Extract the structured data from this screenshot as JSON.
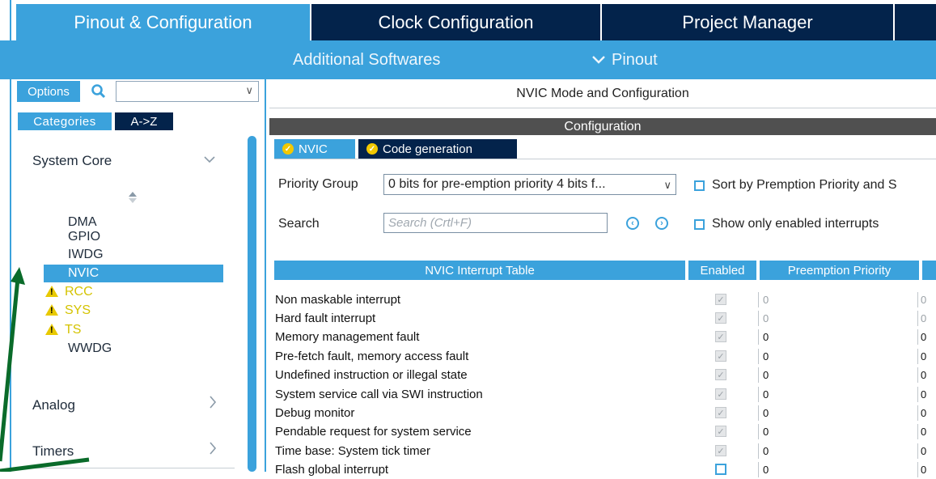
{
  "tabs": {
    "pinout": "Pinout & Configuration",
    "clock": "Clock Configuration",
    "project": "Project Manager"
  },
  "subnav": {
    "additional": "Additional Softwares",
    "pinout": "Pinout"
  },
  "left": {
    "options_label": "Options",
    "categories_label": "Categories",
    "az_label": "A->Z",
    "system_core": "System Core",
    "items": [
      {
        "label": "DMA",
        "state": "normal"
      },
      {
        "label": "GPIO",
        "state": "normal"
      },
      {
        "label": "IWDG",
        "state": "normal"
      },
      {
        "label": "NVIC",
        "state": "selected"
      },
      {
        "label": "RCC",
        "state": "warning"
      },
      {
        "label": "SYS",
        "state": "warning"
      },
      {
        "label": "TS",
        "state": "warning"
      },
      {
        "label": "WWDG",
        "state": "normal"
      }
    ],
    "analog": "Analog",
    "timers": "Timers"
  },
  "right": {
    "title": "NVIC Mode and Configuration",
    "config_header": "Configuration",
    "tab_nvic": "NVIC",
    "tab_codegen": "Code generation",
    "priority_group_label": "Priority Group",
    "priority_group_value": "0 bits for pre-emption priority 4 bits f...",
    "sort_label": "Sort by Premption Priority and S",
    "search_label": "Search",
    "search_placeholder": "Search (Crtl+F)",
    "show_enabled_label": "Show only enabled interrupts",
    "table": {
      "col_name": "NVIC Interrupt Table",
      "col_enabled": "Enabled",
      "col_preemption": "Preemption Priority",
      "rows": [
        {
          "name": "Non maskable interrupt",
          "enabled": true,
          "preemption": "0",
          "sub": "0",
          "dim": true
        },
        {
          "name": "Hard fault interrupt",
          "enabled": true,
          "preemption": "0",
          "sub": "0",
          "dim": true
        },
        {
          "name": "Memory management fault",
          "enabled": true,
          "preemption": "0",
          "sub": "0",
          "dim": false
        },
        {
          "name": "Pre-fetch fault, memory access fault",
          "enabled": true,
          "preemption": "0",
          "sub": "0",
          "dim": false
        },
        {
          "name": "Undefined instruction or illegal state",
          "enabled": true,
          "preemption": "0",
          "sub": "0",
          "dim": false
        },
        {
          "name": "System service call via SWI instruction",
          "enabled": true,
          "preemption": "0",
          "sub": "0",
          "dim": false
        },
        {
          "name": "Debug monitor",
          "enabled": true,
          "preemption": "0",
          "sub": "0",
          "dim": false
        },
        {
          "name": "Pendable request for system service",
          "enabled": true,
          "preemption": "0",
          "sub": "0",
          "dim": false
        },
        {
          "name": "Time base: System tick timer",
          "enabled": true,
          "preemption": "0",
          "sub": "0",
          "dim": false
        },
        {
          "name": "Flash global interrupt",
          "enabled": false,
          "preemption": "0",
          "sub": "0",
          "dim": false
        }
      ]
    }
  },
  "colors": {
    "accent": "#3ba2dc",
    "dark_navy": "#03234b",
    "warning": "#d4c300",
    "arrow": "#0a6b2a"
  }
}
